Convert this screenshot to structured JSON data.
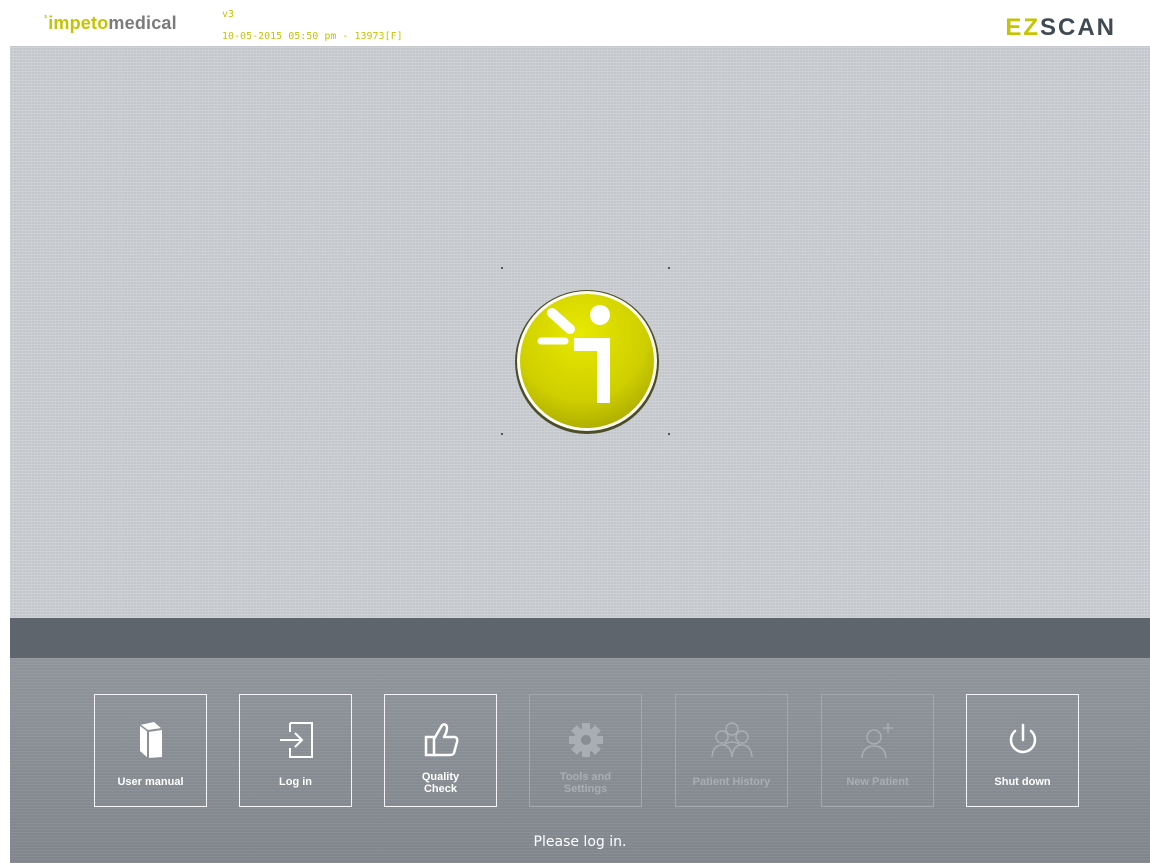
{
  "header": {
    "logo_mark": "³",
    "logo_part1": "impeto",
    "logo_part2": "medical",
    "version": "v3",
    "datetime_line": "10-05-2015 05:50 pm - 13973[F]",
    "product_part1": "EZ",
    "product_part2": "SCAN"
  },
  "colors": {
    "accent": "#c5c400",
    "canvas": "#c4c7cc",
    "band": "#5e656c",
    "toolbar": "#868c92"
  },
  "toolbar": {
    "buttons": [
      {
        "label": "User manual",
        "icon": "book-icon",
        "enabled": true
      },
      {
        "label": "Log in",
        "icon": "login-arrow-icon",
        "enabled": true
      },
      {
        "label": "Quality\nCheck",
        "icon": "thumbs-up-icon",
        "enabled": true
      },
      {
        "label": "Tools and\nSettings",
        "icon": "gear-icon",
        "enabled": false
      },
      {
        "label": "Patient History",
        "icon": "group-icon",
        "enabled": false
      },
      {
        "label": "New Patient",
        "icon": "add-user-icon",
        "enabled": false
      },
      {
        "label": "Shut down",
        "icon": "power-icon",
        "enabled": true
      }
    ],
    "status_message": "Please log in."
  }
}
